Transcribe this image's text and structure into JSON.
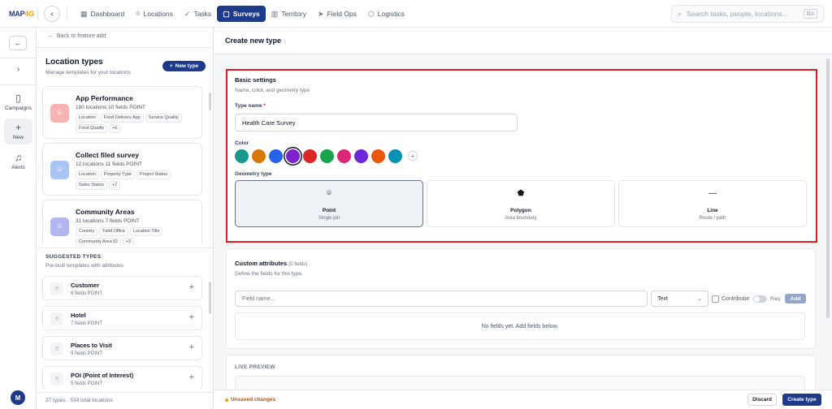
{
  "app": {
    "logo_main": "MAP",
    "logo_accent": "4G"
  },
  "nav": [
    {
      "label": "Dashboard",
      "icon": "bar-chart-icon",
      "glyph": "▦"
    },
    {
      "label": "Locations",
      "icon": "map-pin-icon",
      "glyph": "⌾"
    },
    {
      "label": "Tasks",
      "icon": "check-icon",
      "glyph": "✓"
    },
    {
      "label": "Surveys",
      "icon": "clipboard-icon",
      "glyph": "▢",
      "active": true
    },
    {
      "label": "Territory",
      "icon": "map-icon",
      "glyph": "▥"
    },
    {
      "label": "Field Ops",
      "icon": "send-icon",
      "glyph": "➤"
    },
    {
      "label": "Logistics",
      "icon": "box-icon",
      "glyph": "⬡"
    }
  ],
  "search": {
    "placeholder": "Search tasks, people, locations...",
    "shortcut": "⌘K"
  },
  "rail": {
    "campaigns": "Campaigns",
    "new": "New",
    "alerts": "Alerts",
    "avatar": "M"
  },
  "left": {
    "back": "Back to feature add",
    "title": "Location types",
    "subtitle": "Manage templates for your locations",
    "new_type": "New type",
    "types": [
      {
        "name": "App Performance",
        "locations": "180 locations",
        "fields": "10 fields",
        "geom": "POINT",
        "tags": [
          "Location",
          "Food Delivery App",
          "Service Quality",
          "Food Quality",
          "+6"
        ],
        "color": "#ef4444",
        "bg": "#f8b4b4"
      },
      {
        "name": "Collect filed survey",
        "locations": "12 locations",
        "fields": "11 fields",
        "geom": "POINT",
        "tags": [
          "Location",
          "Property Type",
          "Project Status",
          "Sales Status",
          "+7"
        ],
        "color": "#3b82f6",
        "bg": "#a9c4f5"
      },
      {
        "name": "Community Areas",
        "locations": "31 locations",
        "fields": "7 fields",
        "geom": "POINT",
        "tags": [
          "Country",
          "Field Office",
          "Location Title",
          "Community Area ID",
          "+3"
        ],
        "color": "#6366f1",
        "bg": "#b3b5ef"
      }
    ],
    "suggested_title": "SUGGESTED TYPES",
    "suggested_sub": "Pre-built templates with attributes",
    "suggested": [
      {
        "name": "Customer",
        "meta": "6 fields  POINT"
      },
      {
        "name": "Hotel",
        "meta": "7 fields  POINT"
      },
      {
        "name": "Places to Visit",
        "meta": "9 fields  POINT"
      },
      {
        "name": "POI (Point of Interest)",
        "meta": "5 fields  POINT"
      }
    ],
    "footer": "27 types · 534 total locations"
  },
  "main": {
    "title": "Create new type",
    "basic": {
      "title": "Basic settings",
      "subtitle": "Name, color, and geometry type",
      "type_name_label": "Type name",
      "type_name_req": "*",
      "type_name_value": "Health Care Survey",
      "color_label": "Color",
      "colors": [
        "#179a8c",
        "#d97706",
        "#2563eb",
        "#7e22ce",
        "#dc2626",
        "#16a34a",
        "#db2777",
        "#6d28d9",
        "#ea580c",
        "#0891b2"
      ],
      "selected_color_index": 3,
      "geometry_label": "Geometry type",
      "geometries": [
        {
          "name": "Point",
          "sub": "Single pin",
          "glyph": "⌾",
          "icon": "map-pin-icon"
        },
        {
          "name": "Polygon",
          "sub": "Area boundary",
          "glyph": "⬟",
          "icon": "polygon-icon"
        },
        {
          "name": "Line",
          "sub": "Route / path",
          "glyph": "—",
          "icon": "line-icon"
        }
      ],
      "selected_geometry": "Point"
    },
    "attributes": {
      "title": "Custom attributes",
      "count": "(0 fields)",
      "subtitle": "Define the fields for this type.",
      "field_placeholder": "Field name...",
      "type_value": "Text",
      "contributor": "Contributor",
      "req": "Req.",
      "add": "Add",
      "empty": "No fields yet. Add fields below."
    },
    "preview": {
      "title": "LIVE PREVIEW"
    }
  },
  "footer": {
    "unsaved": "Unsaved changes",
    "discard": "Discard",
    "create": "Create type"
  }
}
